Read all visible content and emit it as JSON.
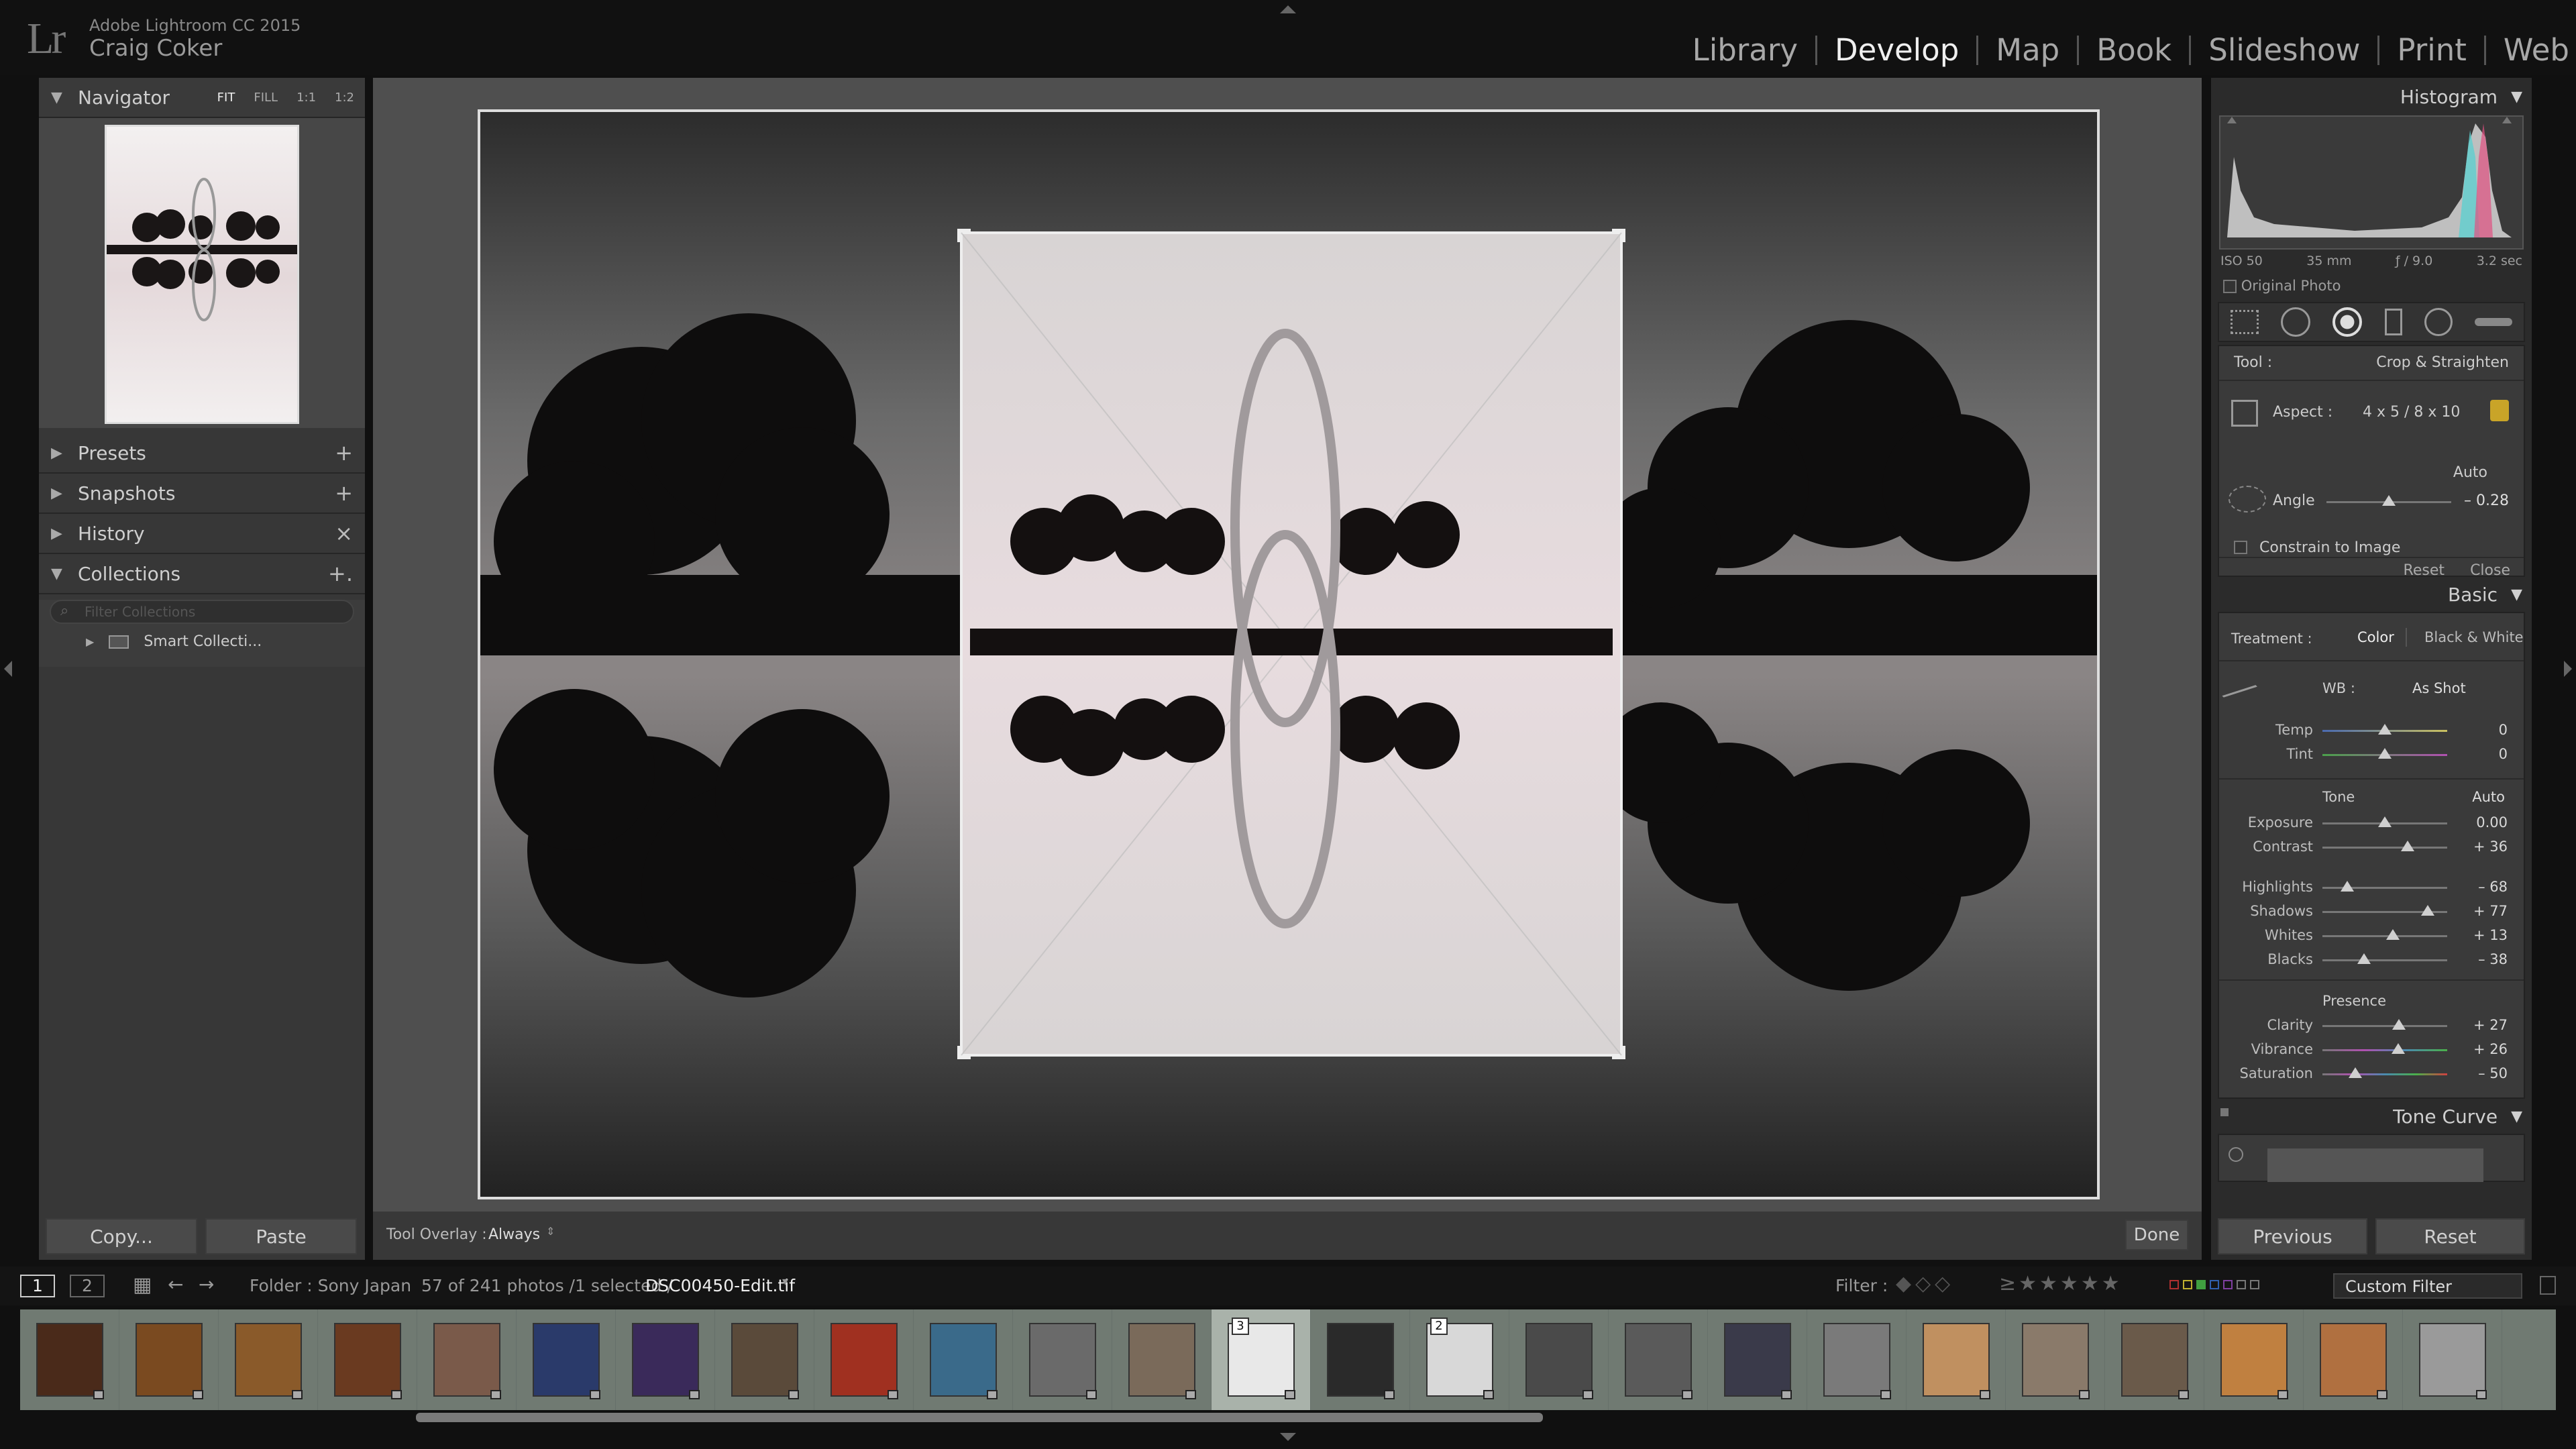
{
  "app": {
    "product": "Adobe Lightroom CC 2015",
    "user": "Craig Coker",
    "logo": "Lr"
  },
  "modules": [
    "Library",
    "Develop",
    "Map",
    "Book",
    "Slideshow",
    "Print",
    "Web"
  ],
  "active_module": "Develop",
  "left_panel": {
    "navigator": {
      "title": "Navigator",
      "zoom": [
        "FIT",
        "FILL",
        "1:1",
        "1:2"
      ]
    },
    "sections": [
      {
        "label": "Presets",
        "action": "+"
      },
      {
        "label": "Snapshots",
        "action": "+"
      },
      {
        "label": "History",
        "action": "×"
      },
      {
        "label": "Collections",
        "action": "+."
      }
    ],
    "filter_placeholder": "Filter Collections",
    "smart_collection": "Smart Collecti...",
    "copy_label": "Copy...",
    "paste_label": "Paste"
  },
  "toolbar": {
    "overlay_label": "Tool Overlay :",
    "overlay_value": "Always",
    "done_label": "Done"
  },
  "right_panel": {
    "histogram": {
      "title": "Histogram",
      "iso": "ISO 50",
      "focal": "35 mm",
      "aperture": "ƒ / 9.0",
      "shutter": "3.2 sec",
      "original_photo": "Original Photo"
    },
    "crop": {
      "tool_label": "Tool :",
      "tool_name": "Crop & Straighten",
      "aspect_label": "Aspect :",
      "aspect_value": "4 x 5  /  8 x 10",
      "auto": "Auto",
      "angle_label": "Angle",
      "angle_value": "– 0.28",
      "constrain": "Constrain to Image",
      "reset": "Reset",
      "close": "Close"
    },
    "basic": {
      "title": "Basic",
      "treatment_label": "Treatment :",
      "color": "Color",
      "bw": "Black & White",
      "wb_label": "WB :",
      "wb_value": "As Shot",
      "temp": {
        "label": "Temp",
        "value": "0"
      },
      "tint": {
        "label": "Tint",
        "value": "0"
      },
      "tone_label": "Tone",
      "tone_auto": "Auto",
      "exposure": {
        "label": "Exposure",
        "value": "0.00"
      },
      "contrast": {
        "label": "Contrast",
        "value": "+ 36"
      },
      "highlights": {
        "label": "Highlights",
        "value": "– 68"
      },
      "shadows": {
        "label": "Shadows",
        "value": "+ 77"
      },
      "whites": {
        "label": "Whites",
        "value": "+ 13"
      },
      "blacks": {
        "label": "Blacks",
        "value": "– 38"
      },
      "presence_label": "Presence",
      "clarity": {
        "label": "Clarity",
        "value": "+ 27"
      },
      "vibrance": {
        "label": "Vibrance",
        "value": "+ 26"
      },
      "saturation": {
        "label": "Saturation",
        "value": "– 50"
      }
    },
    "tone_curve_title": "Tone Curve",
    "previous_label": "Previous",
    "reset_label": "Reset"
  },
  "filmstrip_bar": {
    "page1": "1",
    "page2": "2",
    "folder": "Folder : Sony Japan",
    "count": "57 of 241 photos /1 selected /",
    "filename": "DSC00450-Edit.tif",
    "filter_label": "Filter :",
    "custom_filter": "Custom Filter"
  },
  "filmstrip": {
    "selected_badges": [
      "3",
      "2"
    ],
    "thumb_colors": [
      "#4a2a1a",
      "#7a4a20",
      "#8a5a2a",
      "#6a3a20",
      "#7a5a4a",
      "#2a3a6a",
      "#3a2a5a",
      "#5a4a3a",
      "#a03020",
      "#3a6a8a",
      "#6a6a6a",
      "#7a6a5a",
      "#e8e8e8",
      "#2a2a2a",
      "#d8d8d8",
      "#4a4a4a",
      "#5a5a5a",
      "#3a3a4a",
      "#7a7a7a",
      "#c09060",
      "#8a7a6a",
      "#6a5a4a",
      "#c08040",
      "#b07040",
      "#9a9a9a"
    ]
  },
  "colors": {
    "accent_film": "#707a72",
    "panel": "#373737",
    "frame": "#dddddd"
  }
}
